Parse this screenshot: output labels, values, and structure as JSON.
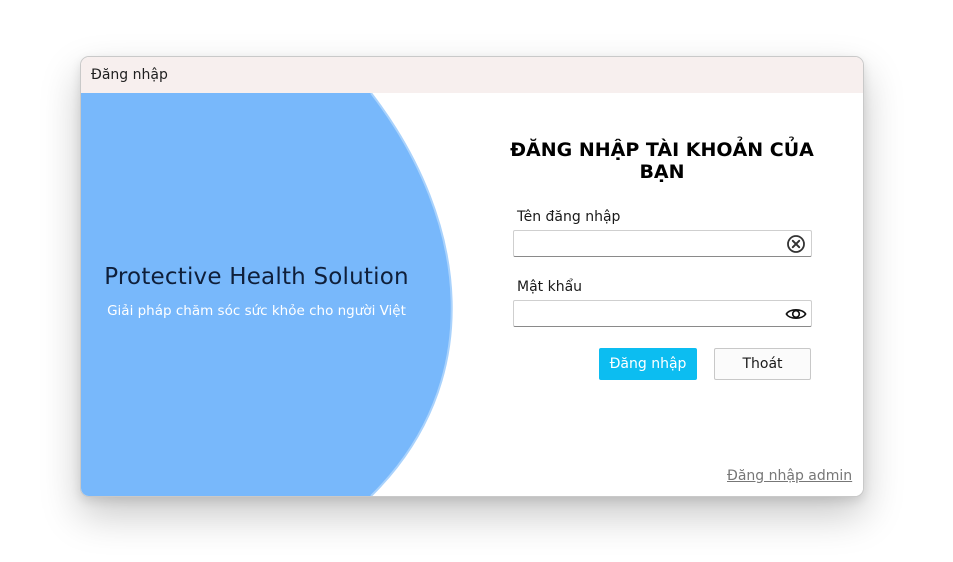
{
  "window": {
    "title": "Đăng nhập"
  },
  "brand": {
    "title": "Protective Health Solution",
    "subtitle": "Giải pháp chăm sóc sức khỏe cho người Việt",
    "panel_color": "#78b8fb"
  },
  "form": {
    "heading": "ĐĂNG NHẬP TÀI KHOẢN CỦA BẠN",
    "username_label": "Tên đăng nhập",
    "username_value": "",
    "username_icon": "clear-icon",
    "password_label": "Mật khẩu",
    "password_value": "",
    "password_icon": "eye-icon",
    "login_button": "Đăng nhập",
    "exit_button": "Thoát",
    "admin_link": "Đăng nhập admin"
  },
  "colors": {
    "accent": "#0cbdf1",
    "titlebar": "#f7efee"
  }
}
